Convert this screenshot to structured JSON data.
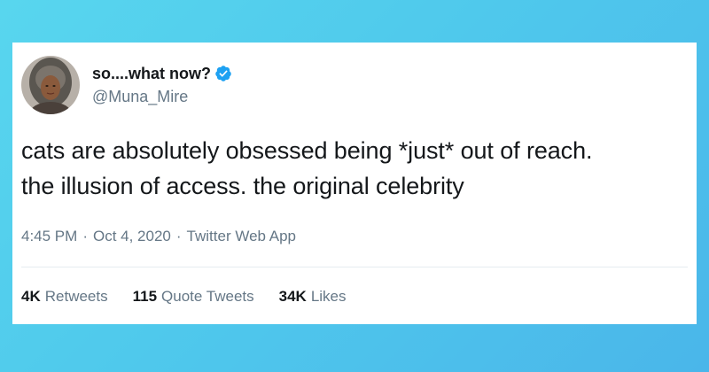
{
  "tweet": {
    "display_name": "so....what now?",
    "handle": "@Muna_Mire",
    "verified": true,
    "text": "cats are absolutely obsessed being *just* out of reach.\nthe illusion of access. the original celebrity",
    "time": "4:45 PM",
    "date": "Oct 4, 2020",
    "source": "Twitter Web App",
    "separator": "·"
  },
  "stats": {
    "retweets": {
      "count": "4K",
      "label": "Retweets"
    },
    "quotes": {
      "count": "115",
      "label": "Quote Tweets"
    },
    "likes": {
      "count": "34K",
      "label": "Likes"
    }
  },
  "colors": {
    "background_gradient": [
      "#58d6ee",
      "#4ab6ea"
    ],
    "verified_badge": "#1da1f2",
    "text_primary": "#14171a",
    "text_secondary": "#657786"
  },
  "icons": {
    "verified": "verified-badge-icon"
  }
}
